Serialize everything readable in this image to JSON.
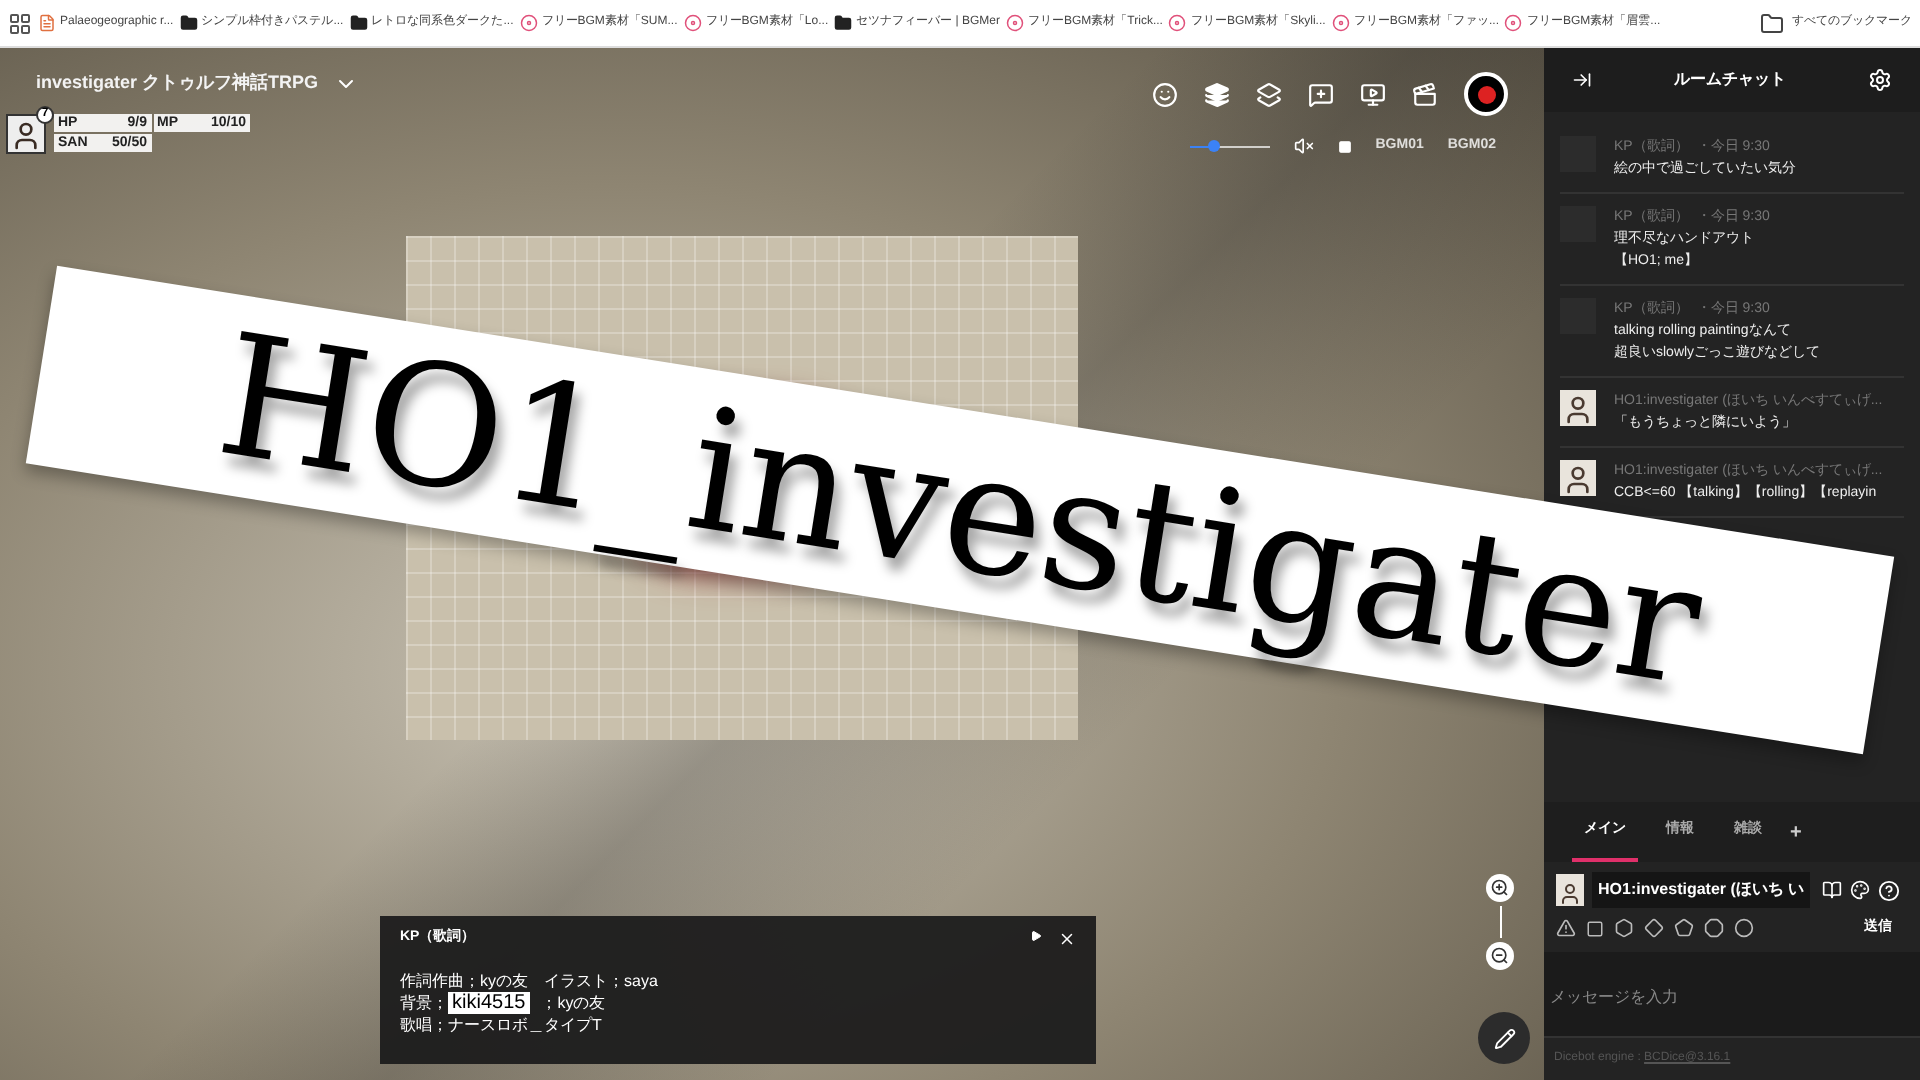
{
  "bookmarks": [
    {
      "label": "Palaeogeographic r...",
      "kind": "page"
    },
    {
      "label": "シンプル枠付きパステル...",
      "kind": "folder"
    },
    {
      "label": "レトロな同系色ダークた...",
      "kind": "folder"
    },
    {
      "label": "フリーBGM素材「SUM...",
      "kind": "bgm"
    },
    {
      "label": "フリーBGM素材「Lo...",
      "kind": "bgm"
    },
    {
      "label": "セツナフィーバー | BGMer",
      "kind": "folder"
    },
    {
      "label": "フリーBGM素材「Trick...",
      "kind": "bgm"
    },
    {
      "label": "フリーBGM素材「Skyli...",
      "kind": "bgm"
    },
    {
      "label": "フリーBGM素材「ファッ...",
      "kind": "bgm"
    },
    {
      "label": "フリーBGM素材「眉雲...",
      "kind": "bgm"
    }
  ],
  "all_bookmarks": "すべてのブックマーク",
  "room_title": "investigater クトゥルフ神話TRPG",
  "character": {
    "badge": "7",
    "stats": [
      {
        "label": "HP",
        "value": "9/9"
      },
      {
        "label": "MP",
        "value": "10/10"
      },
      {
        "label": "SAN",
        "value": "50/50"
      }
    ]
  },
  "volume": {
    "level": 0.3
  },
  "bgm": [
    "BGM01",
    "BGM02"
  ],
  "caption": {
    "speaker": "KP（歌詞）",
    "lines": [
      {
        "text": "作詞作曲；kyの友　イラスト；saya"
      },
      {
        "text": "背景；",
        "label": "kiki4515",
        "rest": "；kyの友"
      },
      {
        "text": "歌唱；ナースロボ＿タイプT"
      }
    ]
  },
  "banner": "HO1_investigater",
  "chat": {
    "title": "ルームチャット",
    "messages": [
      {
        "name": "KP（歌詞）",
        "time": "・今日 9:30",
        "kind": "blank",
        "lines": [
          "絵の中で過ごしていたい気分"
        ]
      },
      {
        "name": "KP（歌詞）",
        "time": "・今日 9:30",
        "kind": "blank",
        "lines": [
          "理不尽なハンドアウト",
          "【HO1; me】"
        ]
      },
      {
        "name": "KP（歌詞）",
        "time": "・今日 9:30",
        "kind": "blank",
        "lines": [
          "talking rolling paintingなんて",
          "超良いslowlyごっこ遊びなどして"
        ]
      },
      {
        "name": "HO1:investigater (ほいち いんべすてぃげ...",
        "kind": "person",
        "lines": [
          "「もうちょっと隣にいよう」"
        ]
      },
      {
        "name": "HO1:investigater (ほいち いんべすてぃげ...",
        "kind": "person",
        "lines": [
          "CCB<=60 【talking】【rolling】【replayin"
        ]
      }
    ],
    "tabs": [
      {
        "label": "メイン",
        "selected": true
      },
      {
        "label": "情報",
        "selected": false
      },
      {
        "label": "雑談",
        "selected": false
      }
    ],
    "add_tab": "+",
    "speaker": "HO1:investigater (ほいち い",
    "send": "送信",
    "placeholder": "メッセージを入力",
    "footer_label": "Dicebot engine : ",
    "footer_link": "BCDice@3.16.1"
  }
}
